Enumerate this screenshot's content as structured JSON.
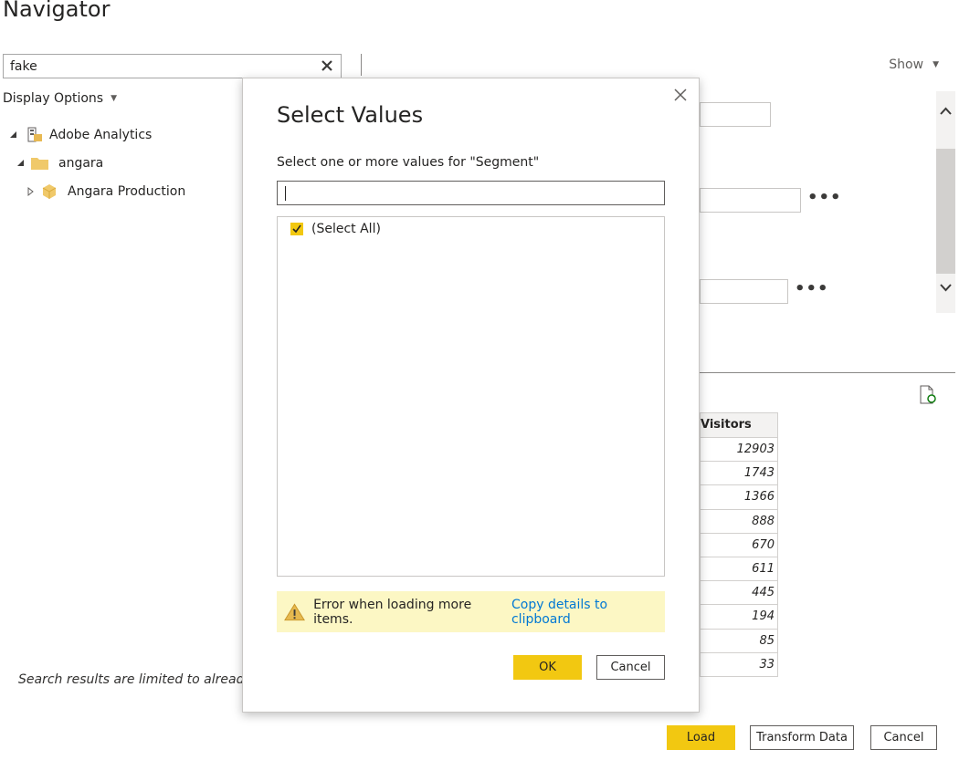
{
  "window": {
    "title": "Navigator"
  },
  "search": {
    "value": "fake",
    "clear_icon": "close-icon"
  },
  "display_options": {
    "label": "Display Options"
  },
  "tree": {
    "items": [
      {
        "label": "Adobe Analytics",
        "icon": "server-icon"
      },
      {
        "label": "angara",
        "icon": "folder-icon"
      },
      {
        "label": "Angara Production",
        "icon": "cube-icon"
      }
    ]
  },
  "show": {
    "label": "Show"
  },
  "preview": {
    "column_header": "Visitors",
    "values": [
      "12903",
      "1743",
      "1366",
      "888",
      "670",
      "611",
      "445",
      "194",
      "85",
      "33"
    ]
  },
  "note": {
    "text": "Search results are limited to already e"
  },
  "footer": {
    "load": "Load",
    "transform": "Transform Data",
    "cancel": "Cancel"
  },
  "modal": {
    "title": "Select Values",
    "label": "Select one or more values for \"Segment\"",
    "search_value": "",
    "select_all": "(Select All)",
    "warning": {
      "text": "Error when loading more items.",
      "link": "Copy details to clipboard"
    },
    "ok": "OK",
    "cancel": "Cancel"
  },
  "colors": {
    "accent": "#f2c811",
    "link": "#0078d4",
    "warning_bg": "#fcf7c4"
  }
}
